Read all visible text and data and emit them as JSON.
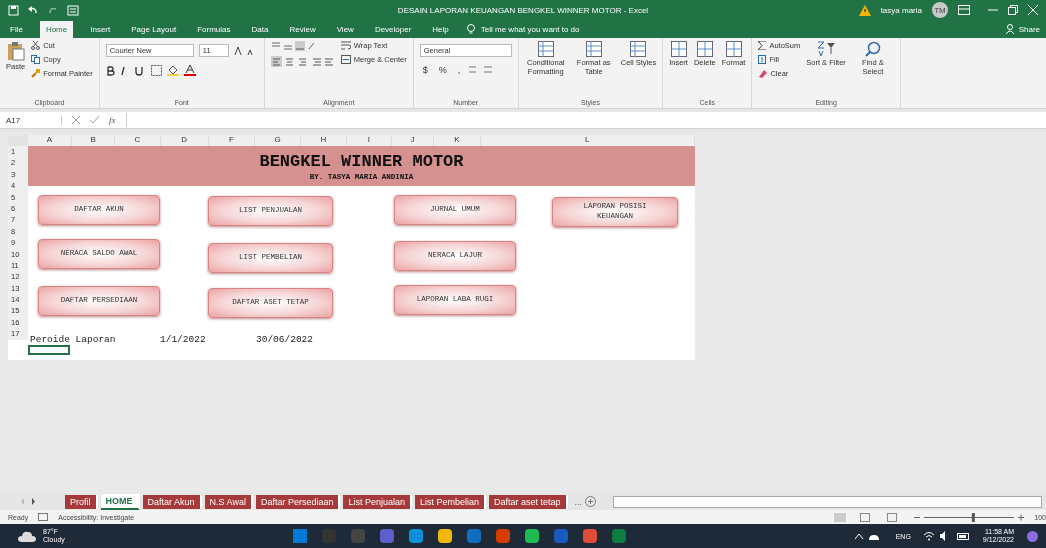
{
  "window": {
    "title": "DESAIN LAPORAN KEUANGAN BENGKEL WINNER MOTOR  -  Excel",
    "user_name": "tasya maria",
    "user_initials": "TM"
  },
  "menu_tabs": [
    {
      "label": "File",
      "selected": false
    },
    {
      "label": "Home",
      "selected": true
    },
    {
      "label": "Insert",
      "selected": false
    },
    {
      "label": "Page Layout",
      "selected": false
    },
    {
      "label": "Formulas",
      "selected": false
    },
    {
      "label": "Data",
      "selected": false
    },
    {
      "label": "Review",
      "selected": false
    },
    {
      "label": "View",
      "selected": false
    },
    {
      "label": "Developer",
      "selected": false
    },
    {
      "label": "Help",
      "selected": false
    }
  ],
  "tell_me": "Tell me what you want to do",
  "share": "Share",
  "ribbon": {
    "clipboard": {
      "label": "Clipboard",
      "paste": "Paste",
      "cut": "Cut",
      "copy": "Copy",
      "format_painter": "Format Painter"
    },
    "font": {
      "label": "Font",
      "family": "Courier New",
      "size": "11"
    },
    "alignment": {
      "label": "Alignment",
      "wrap": "Wrap Text",
      "merge": "Merge & Center"
    },
    "number": {
      "label": "Number",
      "format": "General",
      "currency": "$",
      "percent": "%",
      "comma": ","
    },
    "styles": {
      "label": "Styles",
      "items": [
        "Conditional Formatting",
        "Format as Table",
        "Cell Styles"
      ]
    },
    "cells": {
      "label": "Cells",
      "items": [
        "Insert",
        "Delete",
        "Format"
      ]
    },
    "editing": {
      "label": "Editing",
      "autosum": "AutoSum",
      "fill": "Fill",
      "clear": "Clear",
      "sort": "Sort & Filter",
      "find": "Find & Select"
    }
  },
  "formula_bar": {
    "name_box": "A17",
    "fx": "fx"
  },
  "columns": [
    "A",
    "B",
    "C",
    "D",
    "F",
    "G",
    "H",
    "I",
    "J",
    "K",
    "L"
  ],
  "rows": [
    "1",
    "2",
    "3",
    "4",
    "5",
    "6",
    "7",
    "8",
    "9",
    "10",
    "11",
    "12",
    "13",
    "14",
    "15",
    "16",
    "17"
  ],
  "sheet": {
    "title": "BENGKEL WINNER MOTOR",
    "subtitle": "BY. TASYA MARIA ANDINIA",
    "button_columns": [
      [
        "DAFTAR AKUN",
        "NERACA SALDO AWAL",
        "DAFTAR PERSEDIAAN"
      ],
      [
        "LIST PENJUALAN",
        "LIST PEMBELIAN",
        "DAFTAR ASET TETAP"
      ],
      [
        "JURNAL UMUM",
        "NERACA LAJUR",
        "LAPORAN LABA RUGI"
      ],
      [
        "LAPORAN POSISI KEUANGAN"
      ]
    ],
    "period_label": "Peroide Laporan",
    "period_start": "1/1/2022",
    "period_end": "30/06/2022"
  },
  "sheet_tabs": [
    {
      "label": "Profil",
      "selected": false
    },
    {
      "label": "HOME",
      "selected": true
    },
    {
      "label": "Daftar Akun",
      "selected": false
    },
    {
      "label": "N.S Awal",
      "selected": false
    },
    {
      "label": "Daftar Persediaan",
      "selected": false
    },
    {
      "label": "List Penjualan",
      "selected": false
    },
    {
      "label": "List Pembelian",
      "selected": false
    },
    {
      "label": "Daftar aset tetap",
      "selected": false
    }
  ],
  "more_tabs": "...",
  "status_bar": {
    "ready": "Ready",
    "accessibility": "Accessibility: Investigate",
    "zoom": "100",
    "zoom_slider": {
      "level": 0.55
    }
  },
  "taskbar": {
    "temperature": "87°F",
    "weather": "Cloudy",
    "language": "ENG",
    "time": "11:58 AM",
    "date": "9/12/2022"
  }
}
